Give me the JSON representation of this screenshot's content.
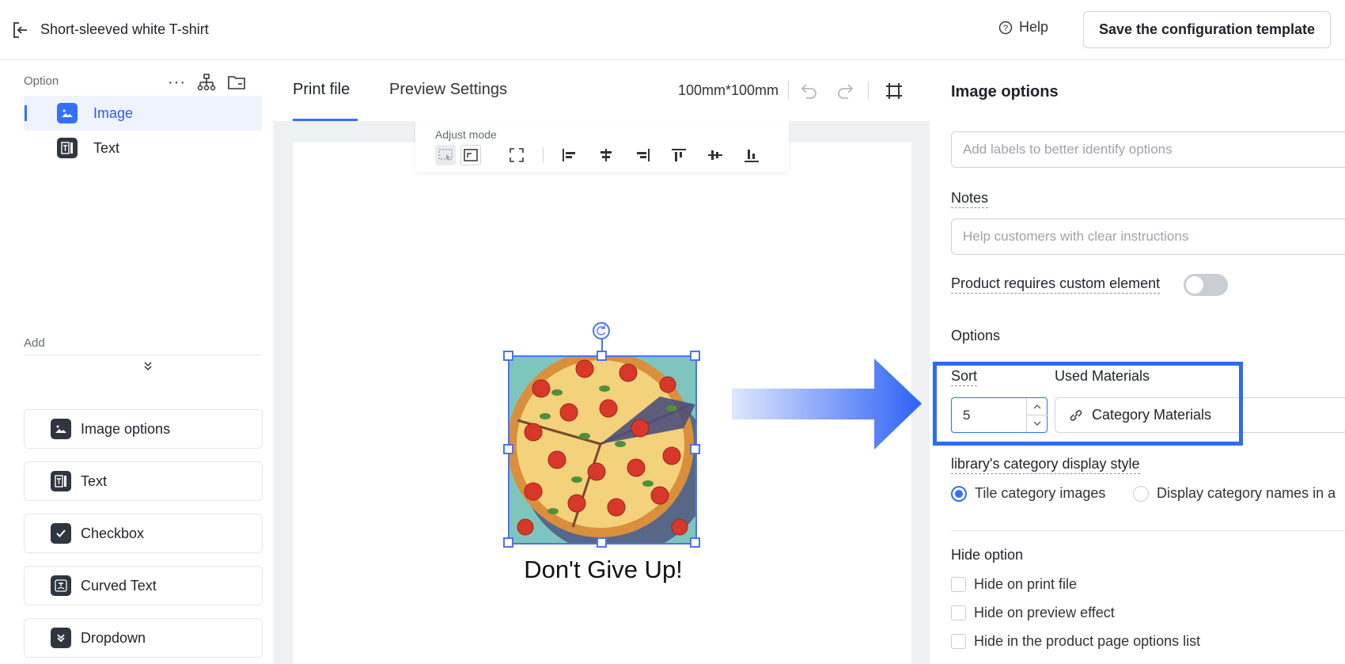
{
  "topbar": {
    "title": "Short-sleeved white T-shirt",
    "help": "Help",
    "save": "Save the configuration template"
  },
  "left": {
    "option_label": "Option",
    "tree": [
      {
        "label": "Image",
        "icon": "image-icon",
        "active": true
      },
      {
        "label": "Text",
        "icon": "text-icon",
        "active": false
      }
    ],
    "add_label": "Add",
    "add_items": [
      {
        "label": "Image options",
        "icon": "image-options-icon"
      },
      {
        "label": "Text",
        "icon": "text-icon"
      },
      {
        "label": "Checkbox",
        "icon": "checkbox-icon"
      },
      {
        "label": "Curved Text",
        "icon": "curved-text-icon"
      },
      {
        "label": "Dropdown",
        "icon": "dropdown-icon"
      }
    ]
  },
  "center": {
    "tabs": [
      "Print file",
      "Preview Settings"
    ],
    "active_tab": "Print file",
    "dimensions": "100mm*100mm",
    "adjust_mode": "Adjust mode",
    "quote": "Don't Give Up!"
  },
  "right": {
    "title": "Image options",
    "label_placeholder": "Add labels to better identify options",
    "notes_label": "Notes",
    "notes_placeholder": "Help customers with clear instructions",
    "requires_custom": "Product requires custom element",
    "requires_custom_on": false,
    "options_label": "Options",
    "sort_label": "Sort",
    "sort_value": "5",
    "used_materials_label": "Used Materials",
    "category_materials": "Category Materials",
    "display_style_label": "library's category display style",
    "radio_options": [
      {
        "label": "Tile category images",
        "selected": true
      },
      {
        "label": "Display category names in a",
        "selected": false
      }
    ],
    "hide_option_label": "Hide option",
    "hide_checks": [
      {
        "label": "Hide on print file",
        "checked": false
      },
      {
        "label": "Hide on preview effect",
        "checked": false
      },
      {
        "label": "Hide in the product page options list",
        "checked": false
      }
    ]
  },
  "colors": {
    "accent": "#3370ff",
    "highlight": "#2d6cf0",
    "arrow": "#2d62f5"
  }
}
